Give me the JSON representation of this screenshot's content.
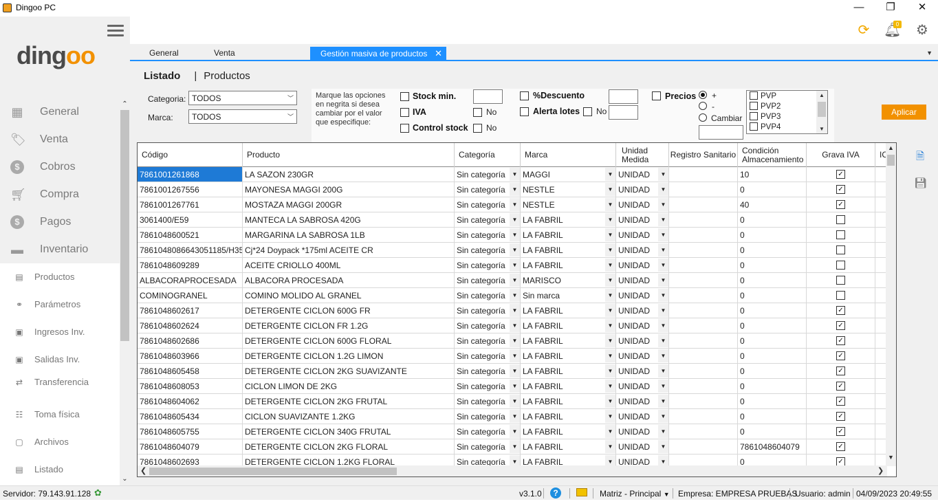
{
  "window": {
    "title": "Dingoo PC",
    "minimize": "—",
    "maximize": "❐",
    "close": "✕"
  },
  "sidebar": {
    "logo_main": "ding",
    "logo_accent": "oo",
    "items": [
      {
        "label": "General",
        "icon": "general-icon"
      },
      {
        "label": "Venta",
        "icon": "tag-icon"
      },
      {
        "label": "Cobros",
        "icon": "dollar-icon"
      },
      {
        "label": "Compra",
        "icon": "cart-icon"
      },
      {
        "label": "Pagos",
        "icon": "dollar-icon"
      },
      {
        "label": "Inventario",
        "icon": "inventory-icon"
      }
    ],
    "subitems": [
      {
        "label": "Productos",
        "icon": "products-icon"
      },
      {
        "label": "Parámetros",
        "icon": "params-icon"
      },
      {
        "label": "Ingresos Inv.",
        "icon": "inbox-icon"
      },
      {
        "label": "Salidas Inv.",
        "icon": "outbox-icon"
      },
      {
        "label": "Transferencia",
        "icon": "transfer-icon"
      },
      {
        "label": "Toma física",
        "icon": "stock-count-icon"
      },
      {
        "label": "Archivos",
        "icon": "archive-icon"
      },
      {
        "label": "Listado",
        "icon": "list-icon"
      }
    ]
  },
  "header": {
    "notifications_count": "0"
  },
  "tabs": [
    {
      "label": "General"
    },
    {
      "label": "Venta"
    },
    {
      "label": "Gestión masiva de productos",
      "active": true
    }
  ],
  "page": {
    "heading_bold": "Listado",
    "heading_sep": "|",
    "heading_sub": "Productos"
  },
  "filters": {
    "categoria_label": "Categoria:",
    "categoria_value": "TODOS",
    "marca_label": "Marca:",
    "marca_value": "TODOS"
  },
  "options": {
    "hint": "Marque las opciones en negrita si desea cambiar por el valor que especifique:",
    "stock_min": "Stock min.",
    "iva": "IVA",
    "iva_no": "No",
    "control_stock": "Control stock",
    "control_no": "No",
    "descuento": "%Descuento",
    "alerta_lotes": "Alerta lotes",
    "alerta_no": "No",
    "precios": "Precios",
    "radio_plus": "+",
    "radio_minus": "-",
    "radio_cambiar": "Cambiar",
    "pvp_list": [
      "PVP",
      "PVP2",
      "PVP3",
      "PVP4"
    ],
    "aplicar": "Aplicar"
  },
  "grid": {
    "columns": [
      "Código",
      "Producto",
      "Categoría",
      "Marca",
      "Unidad Medida",
      "Registro Sanitario",
      "Condición Almacenamiento",
      "Grava IVA",
      "ICE"
    ],
    "rows": [
      {
        "codigo": "7861001261868",
        "producto": "LA SAZON 230GR",
        "categoria": "Sin categoría",
        "marca": "MAGGI",
        "unidad": "UNIDAD",
        "registro": "",
        "condicion": "10",
        "iva": true
      },
      {
        "codigo": "7861001267556",
        "producto": "MAYONESA MAGGI 200G",
        "categoria": "Sin categoría",
        "marca": "NESTLE",
        "unidad": "UNIDAD",
        "registro": "",
        "condicion": "0",
        "iva": true
      },
      {
        "codigo": "7861001267761",
        "producto": "MOSTAZA MAGGI 200GR",
        "categoria": "Sin categoría",
        "marca": "NESTLE",
        "unidad": "UNIDAD",
        "registro": "",
        "condicion": "40",
        "iva": true
      },
      {
        "codigo": "3061400/E59",
        "producto": "MANTECA LA SABROSA 420G",
        "categoria": "Sin categoría",
        "marca": "LA FABRIL",
        "unidad": "UNIDAD",
        "registro": "",
        "condicion": "0",
        "iva": false
      },
      {
        "codigo": "7861048600521",
        "producto": "MARGARINA LA SABROSA 1LB",
        "categoria": "Sin categoría",
        "marca": "LA FABRIL",
        "unidad": "UNIDAD",
        "registro": "",
        "condicion": "0",
        "iva": false
      },
      {
        "codigo": "7861048086643051185/H35",
        "producto": "Cj*24 Doypack *175ml ACEITE CR",
        "categoria": "Sin categoría",
        "marca": "LA FABRIL",
        "unidad": "UNIDAD",
        "registro": "",
        "condicion": "0",
        "iva": false
      },
      {
        "codigo": "7861048609289",
        "producto": "ACEITE CRIOLLO 400ML",
        "categoria": "Sin categoría",
        "marca": "LA FABRIL",
        "unidad": "UNIDAD",
        "registro": "",
        "condicion": "0",
        "iva": false
      },
      {
        "codigo": "ALBACORAPROCESADA",
        "producto": "ALBACORA PROCESADA",
        "categoria": "Sin categoría",
        "marca": "MARISCO",
        "unidad": "UNIDAD",
        "registro": "",
        "condicion": "0",
        "iva": false
      },
      {
        "codigo": "COMINOGRANEL",
        "producto": "COMINO MOLIDO AL GRANEL",
        "categoria": "Sin categoría",
        "marca": "Sin marca",
        "unidad": "UNIDAD",
        "registro": "",
        "condicion": "0",
        "iva": false
      },
      {
        "codigo": "7861048602617",
        "producto": "DETERGENTE CICLON 600G FR",
        "categoria": "Sin categoría",
        "marca": "LA FABRIL",
        "unidad": "UNIDAD",
        "registro": "",
        "condicion": "0",
        "iva": true
      },
      {
        "codigo": "7861048602624",
        "producto": "DETERGENTE CICLON FR 1.2G",
        "categoria": "Sin categoría",
        "marca": "LA FABRIL",
        "unidad": "UNIDAD",
        "registro": "",
        "condicion": "0",
        "iva": true
      },
      {
        "codigo": "7861048602686",
        "producto": "DETERGENTE CICLON 600G FLORAL",
        "categoria": "Sin categoría",
        "marca": "LA FABRIL",
        "unidad": "UNIDAD",
        "registro": "",
        "condicion": "0",
        "iva": true
      },
      {
        "codigo": "7861048603966",
        "producto": "DETERGENTE CICLON 1.2G LIMON",
        "categoria": "Sin categoría",
        "marca": "LA FABRIL",
        "unidad": "UNIDAD",
        "registro": "",
        "condicion": "0",
        "iva": true
      },
      {
        "codigo": "7861048605458",
        "producto": "DETERGENTE CICLON 2KG SUAVIZANTE",
        "categoria": "Sin categoría",
        "marca": "LA FABRIL",
        "unidad": "UNIDAD",
        "registro": "",
        "condicion": "0",
        "iva": true
      },
      {
        "codigo": "7861048608053",
        "producto": "CICLON LIMON DE 2KG",
        "categoria": "Sin categoría",
        "marca": "LA FABRIL",
        "unidad": "UNIDAD",
        "registro": "",
        "condicion": "0",
        "iva": true
      },
      {
        "codigo": "7861048604062",
        "producto": "DETERGENTE CICLON 2KG FRUTAL",
        "categoria": "Sin categoría",
        "marca": "LA FABRIL",
        "unidad": "UNIDAD",
        "registro": "",
        "condicion": "0",
        "iva": true
      },
      {
        "codigo": "7861048605434",
        "producto": "CICLON SUAVIZANTE 1.2KG",
        "categoria": "Sin categoría",
        "marca": "LA FABRIL",
        "unidad": "UNIDAD",
        "registro": "",
        "condicion": "0",
        "iva": true
      },
      {
        "codigo": "7861048605755",
        "producto": "DETERGENTE CICLON 340G FRUTAL",
        "categoria": "Sin categoría",
        "marca": "LA FABRIL",
        "unidad": "UNIDAD",
        "registro": "",
        "condicion": "0",
        "iva": true
      },
      {
        "codigo": "7861048604079",
        "producto": "DETERGENTE CICLON 2KG FLORAL",
        "categoria": "Sin categoría",
        "marca": "LA FABRIL",
        "unidad": "UNIDAD",
        "registro": "",
        "condicion": "7861048604079",
        "iva": true
      },
      {
        "codigo": "7861048602693",
        "producto": "DETERGENTE CICLON 1.2KG FLORAL",
        "categoria": "Sin categoría",
        "marca": "LA FABRIL",
        "unidad": "UNIDAD",
        "registro": "",
        "condicion": "0",
        "iva": true
      }
    ]
  },
  "statusbar": {
    "server": "Servidor: 79.143.91.128",
    "version": "v3.1.0",
    "branch": "Matriz - Principal",
    "empresa": "Empresa: EMPRESA PRUEBAS",
    "usuario": "Usuario: admin",
    "datetime": "04/09/2023 20:49:55"
  },
  "colors": {
    "accent": "#1e90ff",
    "brand_orange": "#f29100",
    "selection": "#1e7ad6"
  }
}
